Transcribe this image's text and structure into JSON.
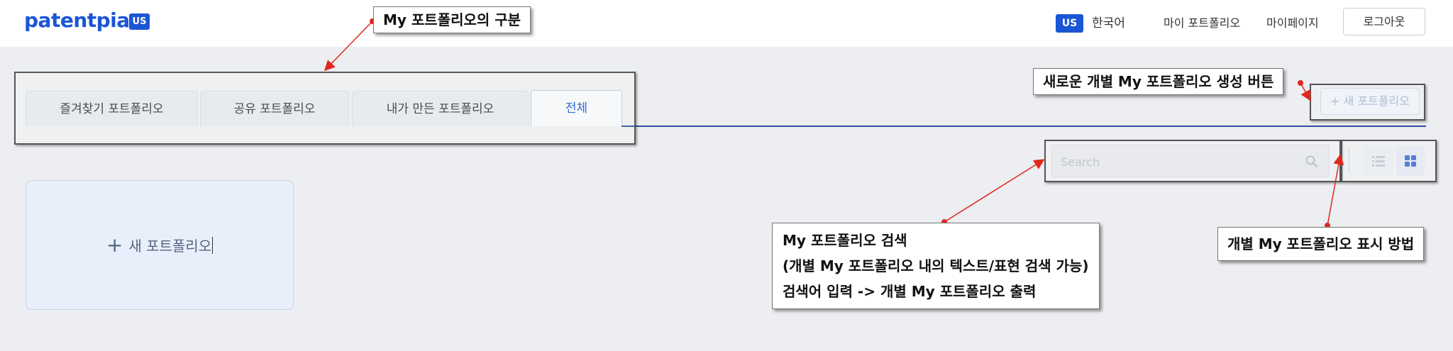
{
  "header": {
    "logo": "patentpia",
    "logo_badge": "US",
    "lang_badge": "US",
    "lang_label": "한국어",
    "nav": [
      "마이 포트폴리오",
      "마이페이지"
    ],
    "logout": "로그아웃"
  },
  "tabs": [
    {
      "label": "즐겨찾기 포트폴리오",
      "active": false
    },
    {
      "label": "공유 포트폴리오",
      "active": false
    },
    {
      "label": "내가 만든 포트폴리오",
      "active": false
    },
    {
      "label": "전체",
      "active": true
    }
  ],
  "new_portfolio_button": "+ 새 포트폴리오",
  "search": {
    "placeholder": "Search",
    "value": ""
  },
  "view_modes": {
    "list": "list-icon",
    "grid": "grid-icon",
    "selected": "grid"
  },
  "new_card": {
    "plus": "+",
    "label": "새 포트폴리오"
  },
  "annotations": {
    "tabs_callout": "My 포트폴리오의 구분",
    "new_button_callout": "새로운 개별 My 포트폴리오 생성 버튼",
    "search_callout": [
      "My 포트폴리오 검색",
      "(개별 My 포트폴리오 내의 텍스트/표현 검색 가능)",
      "검색어 입력 -> 개별 My 포트폴리오 출력"
    ],
    "view_callout": "개별 My 포트폴리오 표시 방법"
  },
  "colors": {
    "brand": "#1a56d6",
    "tab_line": "#2d4f9c",
    "arrow": "#e0281f"
  }
}
